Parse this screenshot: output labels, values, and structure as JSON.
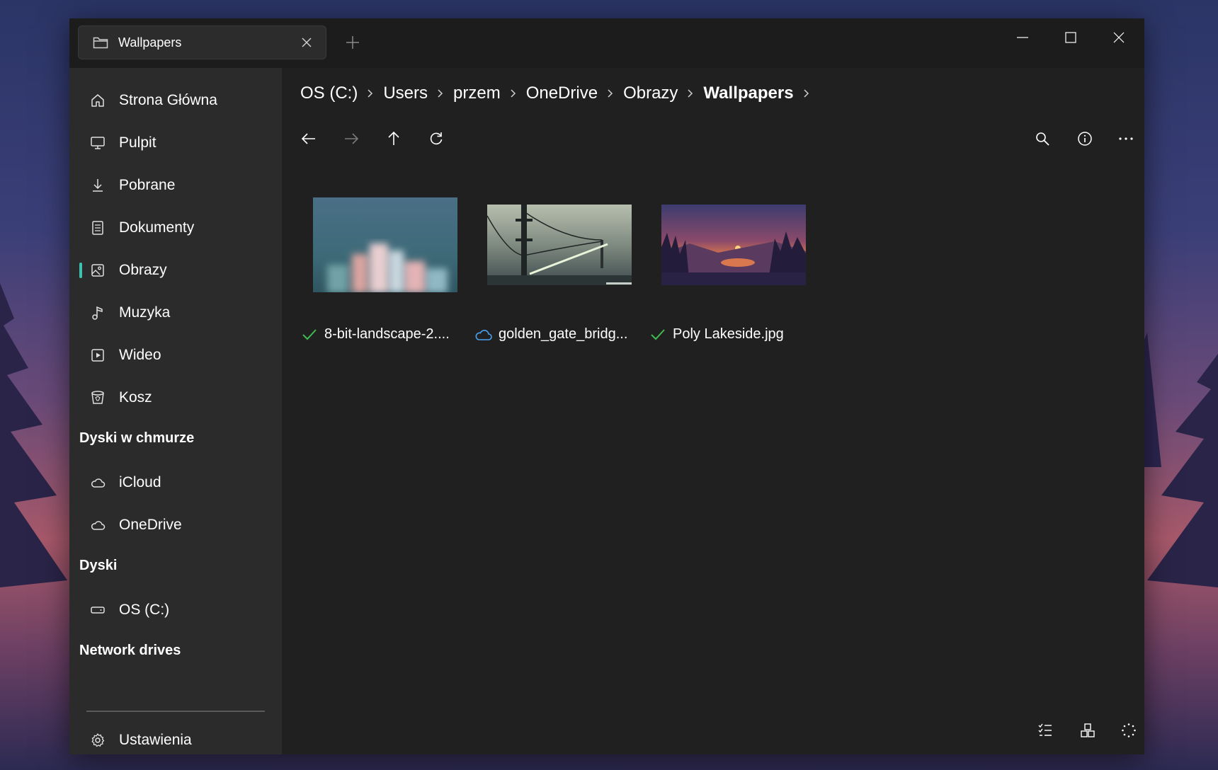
{
  "tab": {
    "title": "Wallpapers",
    "icon": "folder-icon"
  },
  "sidebar": {
    "items": [
      {
        "label": "Strona Główna",
        "icon": "home-icon"
      },
      {
        "label": "Pulpit",
        "icon": "desktop-icon"
      },
      {
        "label": "Pobrane",
        "icon": "download-icon"
      },
      {
        "label": "Dokumenty",
        "icon": "document-icon"
      },
      {
        "label": "Obrazy",
        "icon": "pictures-icon",
        "active": true
      },
      {
        "label": "Muzyka",
        "icon": "music-icon"
      },
      {
        "label": "Wideo",
        "icon": "video-icon"
      },
      {
        "label": "Kosz",
        "icon": "recycle-bin-icon"
      }
    ],
    "cloud_header": "Dyski w chmurze",
    "cloud_items": [
      {
        "label": "iCloud",
        "icon": "cloud-icon"
      },
      {
        "label": "OneDrive",
        "icon": "cloud-icon"
      }
    ],
    "drives_header": "Dyski",
    "drive_items": [
      {
        "label": "OS (C:)",
        "icon": "drive-icon"
      }
    ],
    "network_header": "Network drives",
    "settings_label": "Ustawienia"
  },
  "breadcrumb": [
    "OS (C:)",
    "Users",
    "przem",
    "OneDrive",
    "Obrazy",
    "Wallpapers"
  ],
  "files": [
    {
      "name": "8-bit-landscape-2....",
      "status": "synced-check-icon"
    },
    {
      "name": "golden_gate_bridg...",
      "status": "cloud-only-icon"
    },
    {
      "name": "Poly Lakeside.jpg",
      "status": "synced-check-icon"
    }
  ],
  "colors": {
    "accent": "#3fc1b0",
    "sync_ok": "#3fb950",
    "cloud_only": "#4aa3f0",
    "window_bg": "#202020",
    "sidebar_bg": "#2b2b2b"
  }
}
